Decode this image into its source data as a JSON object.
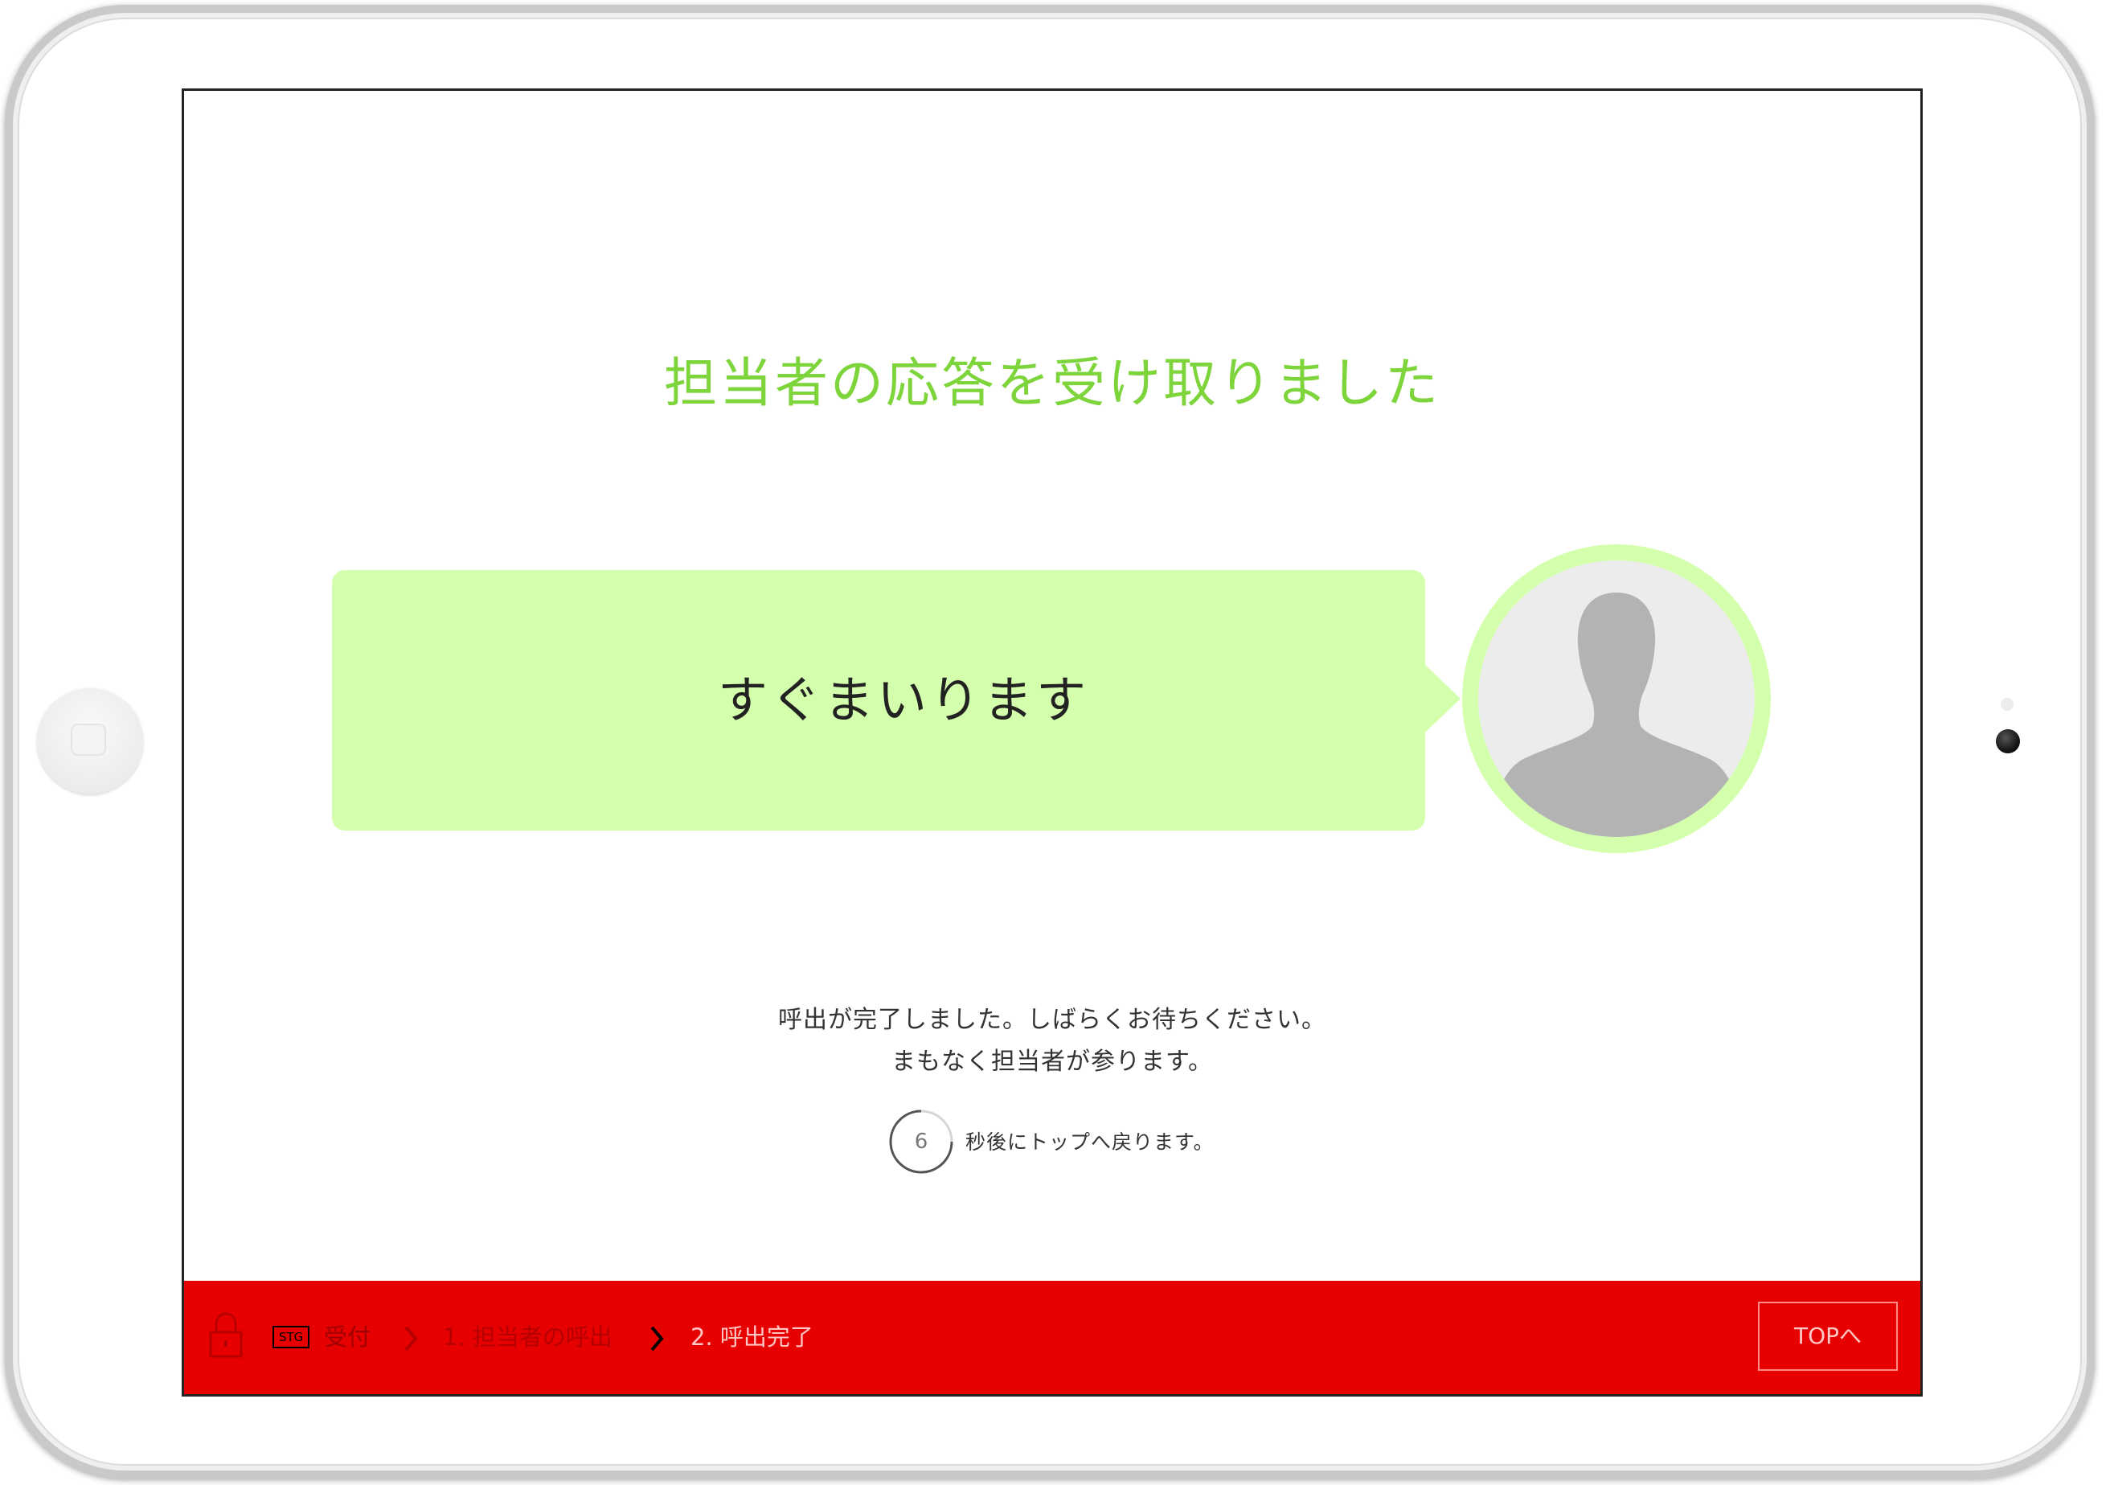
{
  "main": {
    "heading": "担当者の応答を受け取りました",
    "bubble_message": "すぐまいります",
    "message_line1": "呼出が完了しました。しばらくお待ちください。",
    "message_line2": "まもなく担当者が参ります。",
    "countdown": {
      "seconds": "6",
      "text": "秒後にトップへ戻ります。"
    }
  },
  "footer": {
    "badge": "STG",
    "crumbs": {
      "home": "受付",
      "step1": "1. 担当者の呼出",
      "step2": "2. 呼出完了"
    },
    "top_button": "TOPへ"
  },
  "icons": {
    "lock": "lock-icon",
    "chevron": "chevron-right-icon",
    "avatar": "person-silhouette-icon"
  },
  "colors": {
    "heading": "#7dd43b",
    "bubble": "#d4ffac",
    "footer": "#e60000"
  }
}
